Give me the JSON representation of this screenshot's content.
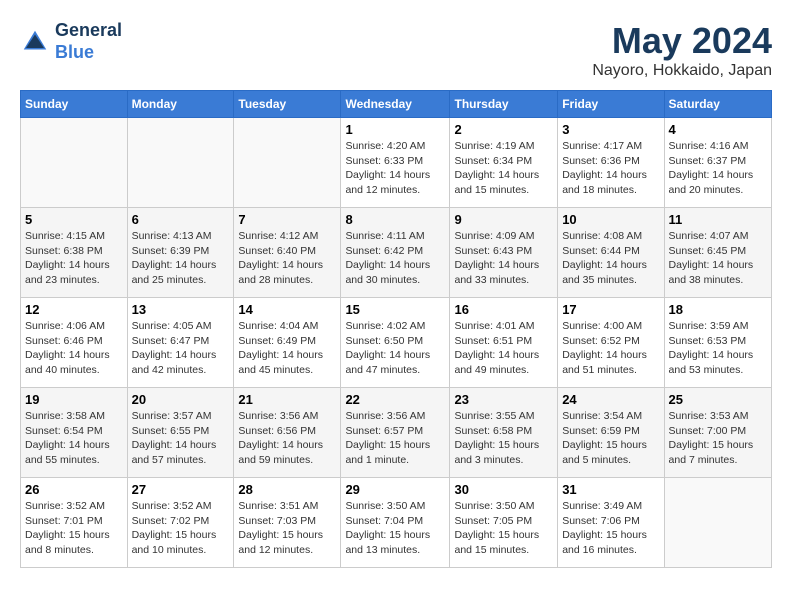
{
  "header": {
    "logo_line1": "General",
    "logo_line2": "Blue",
    "month": "May 2024",
    "location": "Nayoro, Hokkaido, Japan"
  },
  "weekdays": [
    "Sunday",
    "Monday",
    "Tuesday",
    "Wednesday",
    "Thursday",
    "Friday",
    "Saturday"
  ],
  "weeks": [
    {
      "days": [
        {
          "num": "",
          "info": ""
        },
        {
          "num": "",
          "info": ""
        },
        {
          "num": "",
          "info": ""
        },
        {
          "num": "1",
          "info": "Sunrise: 4:20 AM\nSunset: 6:33 PM\nDaylight: 14 hours\nand 12 minutes."
        },
        {
          "num": "2",
          "info": "Sunrise: 4:19 AM\nSunset: 6:34 PM\nDaylight: 14 hours\nand 15 minutes."
        },
        {
          "num": "3",
          "info": "Sunrise: 4:17 AM\nSunset: 6:36 PM\nDaylight: 14 hours\nand 18 minutes."
        },
        {
          "num": "4",
          "info": "Sunrise: 4:16 AM\nSunset: 6:37 PM\nDaylight: 14 hours\nand 20 minutes."
        }
      ]
    },
    {
      "days": [
        {
          "num": "5",
          "info": "Sunrise: 4:15 AM\nSunset: 6:38 PM\nDaylight: 14 hours\nand 23 minutes."
        },
        {
          "num": "6",
          "info": "Sunrise: 4:13 AM\nSunset: 6:39 PM\nDaylight: 14 hours\nand 25 minutes."
        },
        {
          "num": "7",
          "info": "Sunrise: 4:12 AM\nSunset: 6:40 PM\nDaylight: 14 hours\nand 28 minutes."
        },
        {
          "num": "8",
          "info": "Sunrise: 4:11 AM\nSunset: 6:42 PM\nDaylight: 14 hours\nand 30 minutes."
        },
        {
          "num": "9",
          "info": "Sunrise: 4:09 AM\nSunset: 6:43 PM\nDaylight: 14 hours\nand 33 minutes."
        },
        {
          "num": "10",
          "info": "Sunrise: 4:08 AM\nSunset: 6:44 PM\nDaylight: 14 hours\nand 35 minutes."
        },
        {
          "num": "11",
          "info": "Sunrise: 4:07 AM\nSunset: 6:45 PM\nDaylight: 14 hours\nand 38 minutes."
        }
      ]
    },
    {
      "days": [
        {
          "num": "12",
          "info": "Sunrise: 4:06 AM\nSunset: 6:46 PM\nDaylight: 14 hours\nand 40 minutes."
        },
        {
          "num": "13",
          "info": "Sunrise: 4:05 AM\nSunset: 6:47 PM\nDaylight: 14 hours\nand 42 minutes."
        },
        {
          "num": "14",
          "info": "Sunrise: 4:04 AM\nSunset: 6:49 PM\nDaylight: 14 hours\nand 45 minutes."
        },
        {
          "num": "15",
          "info": "Sunrise: 4:02 AM\nSunset: 6:50 PM\nDaylight: 14 hours\nand 47 minutes."
        },
        {
          "num": "16",
          "info": "Sunrise: 4:01 AM\nSunset: 6:51 PM\nDaylight: 14 hours\nand 49 minutes."
        },
        {
          "num": "17",
          "info": "Sunrise: 4:00 AM\nSunset: 6:52 PM\nDaylight: 14 hours\nand 51 minutes."
        },
        {
          "num": "18",
          "info": "Sunrise: 3:59 AM\nSunset: 6:53 PM\nDaylight: 14 hours\nand 53 minutes."
        }
      ]
    },
    {
      "days": [
        {
          "num": "19",
          "info": "Sunrise: 3:58 AM\nSunset: 6:54 PM\nDaylight: 14 hours\nand 55 minutes."
        },
        {
          "num": "20",
          "info": "Sunrise: 3:57 AM\nSunset: 6:55 PM\nDaylight: 14 hours\nand 57 minutes."
        },
        {
          "num": "21",
          "info": "Sunrise: 3:56 AM\nSunset: 6:56 PM\nDaylight: 14 hours\nand 59 minutes."
        },
        {
          "num": "22",
          "info": "Sunrise: 3:56 AM\nSunset: 6:57 PM\nDaylight: 15 hours\nand 1 minute."
        },
        {
          "num": "23",
          "info": "Sunrise: 3:55 AM\nSunset: 6:58 PM\nDaylight: 15 hours\nand 3 minutes."
        },
        {
          "num": "24",
          "info": "Sunrise: 3:54 AM\nSunset: 6:59 PM\nDaylight: 15 hours\nand 5 minutes."
        },
        {
          "num": "25",
          "info": "Sunrise: 3:53 AM\nSunset: 7:00 PM\nDaylight: 15 hours\nand 7 minutes."
        }
      ]
    },
    {
      "days": [
        {
          "num": "26",
          "info": "Sunrise: 3:52 AM\nSunset: 7:01 PM\nDaylight: 15 hours\nand 8 minutes."
        },
        {
          "num": "27",
          "info": "Sunrise: 3:52 AM\nSunset: 7:02 PM\nDaylight: 15 hours\nand 10 minutes."
        },
        {
          "num": "28",
          "info": "Sunrise: 3:51 AM\nSunset: 7:03 PM\nDaylight: 15 hours\nand 12 minutes."
        },
        {
          "num": "29",
          "info": "Sunrise: 3:50 AM\nSunset: 7:04 PM\nDaylight: 15 hours\nand 13 minutes."
        },
        {
          "num": "30",
          "info": "Sunrise: 3:50 AM\nSunset: 7:05 PM\nDaylight: 15 hours\nand 15 minutes."
        },
        {
          "num": "31",
          "info": "Sunrise: 3:49 AM\nSunset: 7:06 PM\nDaylight: 15 hours\nand 16 minutes."
        },
        {
          "num": "",
          "info": ""
        }
      ]
    }
  ]
}
